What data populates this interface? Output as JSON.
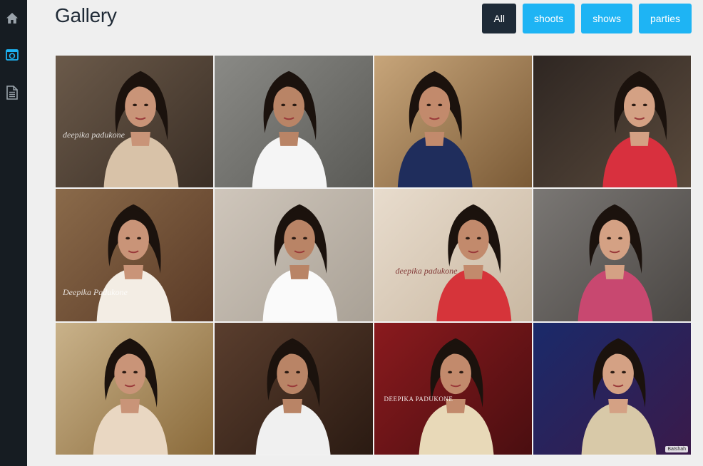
{
  "sidebar": {
    "items": [
      {
        "name": "home-icon",
        "label": "Home"
      },
      {
        "name": "gallery-icon",
        "label": "Gallery"
      },
      {
        "name": "document-icon",
        "label": "Documents"
      }
    ]
  },
  "header": {
    "title": "Gallery"
  },
  "filters": [
    {
      "label": "All",
      "active": true
    },
    {
      "label": "shoots",
      "active": false
    },
    {
      "label": "shows",
      "active": false
    },
    {
      "label": "parties",
      "active": false
    }
  ],
  "colors": {
    "sidebar_bg": "#161c22",
    "page_bg": "#efefef",
    "accent": "#1eb4f4",
    "active_filter": "#1e2a37",
    "sidebar_icon_active": "#1eb4f4",
    "sidebar_icon": "#9aa3ab"
  },
  "gallery": {
    "tiles": [
      {
        "bg": [
          "#6b5a4a",
          "#3a2e25"
        ],
        "dress": "#d8c2a8",
        "watermark": "deepika padukone"
      },
      {
        "bg": [
          "#8a8a86",
          "#5a5a56"
        ],
        "dress": "#f5f5f5",
        "watermark": ""
      },
      {
        "bg": [
          "#c7a57a",
          "#7a5a36"
        ],
        "dress": "#1f2d5c",
        "watermark": ""
      },
      {
        "bg": [
          "#2e2622",
          "#5a4a3c"
        ],
        "dress": "#d8303e",
        "watermark": ""
      },
      {
        "bg": [
          "#8a6a4a",
          "#5a3a26"
        ],
        "dress": "#f3ede4",
        "watermark": "Deepika Padukone"
      },
      {
        "bg": [
          "#cfc6bb",
          "#a9a196"
        ],
        "dress": "#fafafa",
        "watermark": ""
      },
      {
        "bg": [
          "#e8dccd",
          "#c9b8a2"
        ],
        "dress": "#d6343a",
        "watermark": "deepika padukone"
      },
      {
        "bg": [
          "#7a7774",
          "#4b4744"
        ],
        "dress": "#c84870",
        "watermark": ""
      },
      {
        "bg": [
          "#c9b28a",
          "#8a6a3a"
        ],
        "dress": "#e9d7c2",
        "watermark": ""
      },
      {
        "bg": [
          "#5a3e2e",
          "#2a1a12"
        ],
        "dress": "#f0f0f0",
        "watermark": ""
      },
      {
        "bg": [
          "#8a1a1e",
          "#4a0e10"
        ],
        "dress": "#e8d9b8",
        "watermark": "DEEPIKA PADUKONE"
      },
      {
        "bg": [
          "#1a2a6a",
          "#3a1a4a"
        ],
        "dress": "#d8c9a8",
        "watermark": "Batshah"
      }
    ]
  }
}
